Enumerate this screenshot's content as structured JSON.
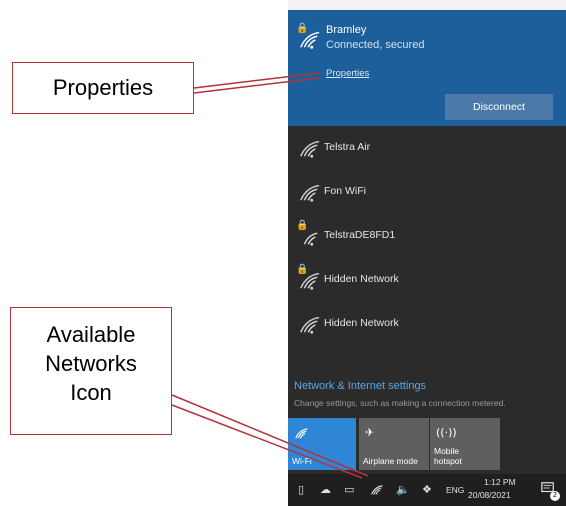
{
  "connected_network": {
    "name": "Bramley",
    "status": "Connected, secured",
    "properties_link": "Properties",
    "disconnect_label": "Disconnect"
  },
  "networks": [
    {
      "name": "Telstra Air",
      "secured": false
    },
    {
      "name": "Fon WiFi",
      "secured": false
    },
    {
      "name": "TelstraDE8FD1",
      "secured": true
    },
    {
      "name": "Hidden Network",
      "secured": true
    },
    {
      "name": "Hidden Network",
      "secured": false
    }
  ],
  "settings": {
    "link": "Network & Internet settings",
    "subtitle": "Change settings, such as making a connection metered."
  },
  "quick_actions": [
    {
      "label": "Wi-Fi",
      "icon": "wifi-icon",
      "active": true
    },
    {
      "label": "Airplane mode",
      "icon": "airplane-icon",
      "active": false
    },
    {
      "label": "Mobile hotspot",
      "icon": "hotspot-icon",
      "active": false
    }
  ],
  "taskbar": {
    "language": "ENG",
    "time": "1:12 PM",
    "date": "20/08/2021",
    "notification_count": "2"
  },
  "callouts": {
    "properties": "Properties",
    "networks_line1": "Available",
    "networks_line2": "Networks",
    "networks_line3": "Icon"
  },
  "colors": {
    "connected_bg": "#1c5f9a",
    "panel_bg": "#2b2b2b",
    "accent": "#2f86d6",
    "callout_border": "#b5323a"
  }
}
